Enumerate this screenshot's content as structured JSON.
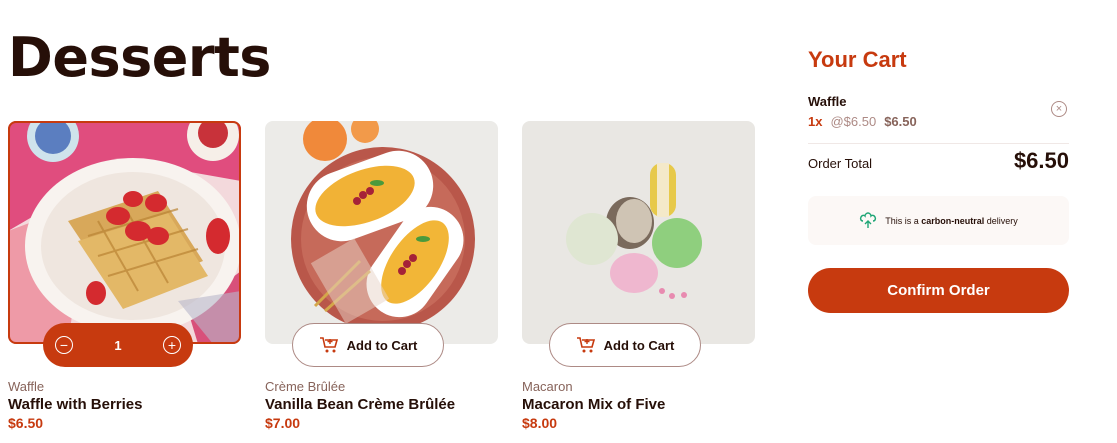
{
  "page": {
    "title": "Desserts"
  },
  "products": [
    {
      "category": "Waffle",
      "name": "Waffle with Berries",
      "price": "$6.50"
    },
    {
      "category": "Crème Brûlée",
      "name": "Vanilla Bean Crème Brûlée",
      "price": "$7.00",
      "button_label": "Add to Cart"
    },
    {
      "category": "Macaron",
      "name": "Macaron Mix of Five",
      "price": "$8.00",
      "button_label": "Add to Cart"
    }
  ],
  "stepper": {
    "quantity": "1"
  },
  "cart": {
    "title": "Your Cart",
    "items": [
      {
        "name": "Waffle",
        "qty": "1x",
        "each": "@$6.50",
        "subtotal": "$6.50"
      }
    ],
    "order_total_label": "Order Total",
    "order_total_value": "$6.50",
    "carbon_prefix": "This is a ",
    "carbon_bold": "carbon-neutral",
    "carbon_suffix": " delivery",
    "confirm_label": "Confirm Order"
  },
  "colors": {
    "accent": "#c73a0f",
    "text": "#260f08",
    "muted": "#87635a"
  }
}
